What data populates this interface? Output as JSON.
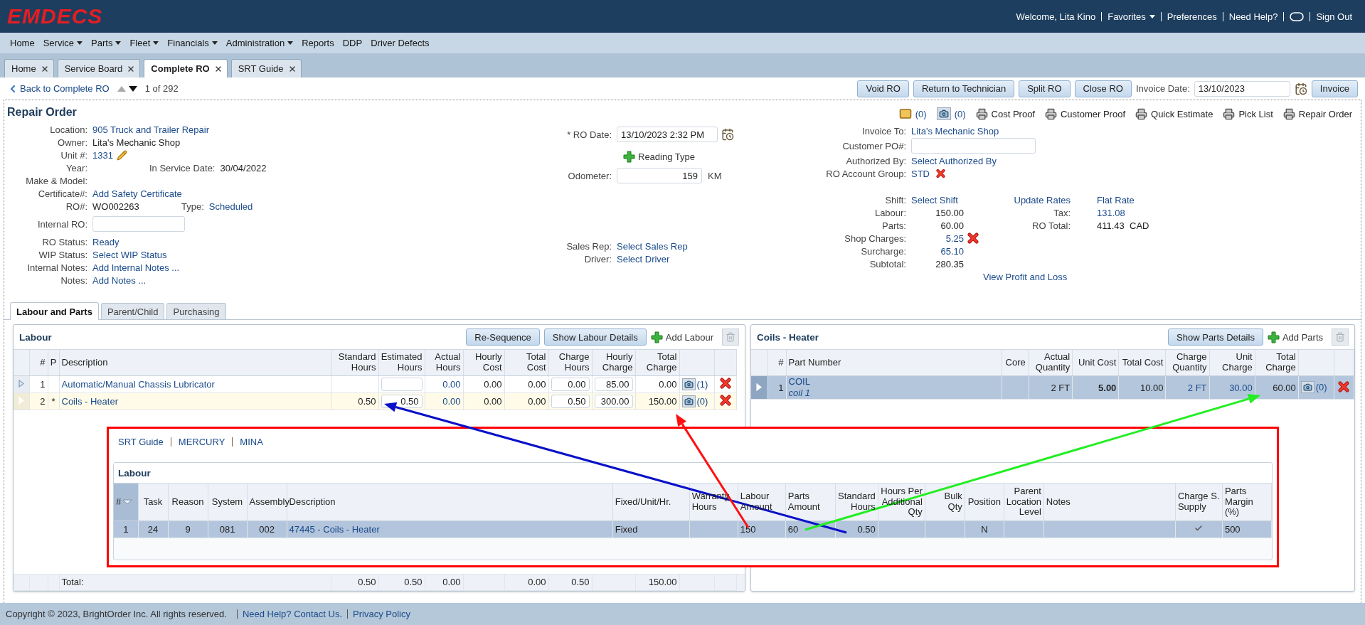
{
  "header": {
    "logo": "EMDECS",
    "items": [
      {
        "label": "Welcome, Lita Kino",
        "kind": "text"
      },
      {
        "label": "Favorites",
        "kind": "menu"
      },
      {
        "label": "Preferences",
        "kind": "link"
      },
      {
        "label": "Need Help?",
        "kind": "link"
      },
      {
        "kind": "toggle"
      },
      {
        "label": "Sign Out",
        "kind": "link"
      }
    ]
  },
  "menu": [
    {
      "label": "Home",
      "dropdown": false
    },
    {
      "label": "Service",
      "dropdown": true
    },
    {
      "label": "Parts",
      "dropdown": true
    },
    {
      "label": "Fleet",
      "dropdown": true
    },
    {
      "label": "Financials",
      "dropdown": true
    },
    {
      "label": "Administration",
      "dropdown": true
    },
    {
      "label": "Reports",
      "dropdown": false
    },
    {
      "label": "DDP",
      "dropdown": false
    },
    {
      "label": "Driver Defects",
      "dropdown": false
    }
  ],
  "tabs": [
    {
      "label": "Home",
      "selected": false
    },
    {
      "label": "Service Board",
      "selected": false
    },
    {
      "label": "Complete RO",
      "selected": true
    },
    {
      "label": "SRT Guide",
      "selected": false
    }
  ],
  "toolbar": {
    "back": "Back to Complete RO",
    "pager": {
      "text": "1 of 292",
      "prev_disabled": true,
      "next_disabled": false
    },
    "buttons": [
      "Void RO",
      "Return to Technician",
      "Split RO",
      "Close RO"
    ],
    "invoice_date_label": "Invoice Date:",
    "invoice_date": "13/10/2023",
    "invoice_button": "Invoice"
  },
  "repair_order": {
    "title": "Repair Order",
    "fields": [
      {
        "label": "Location:",
        "value": "905 Truck and Trailer Repair",
        "kind": "link"
      },
      {
        "label": "Owner:",
        "value": "Lita's Mechanic Shop",
        "kind": "text"
      },
      {
        "label": "Unit #:",
        "value": "1331",
        "kind": "link-edit"
      },
      {
        "label": "Year:",
        "kind": "text",
        "extra": {
          "label": "In Service Date:",
          "value": "30/04/2022",
          "kind": "text"
        }
      },
      {
        "label": "Make & Model:",
        "kind": "text"
      },
      {
        "label": "Certificate#:",
        "value": "Add Safety Certificate",
        "kind": "link"
      },
      {
        "label": "RO#:",
        "value": "WO002263",
        "kind": "text",
        "extra": {
          "label": "Type:",
          "value": "Scheduled",
          "kind": "link"
        }
      },
      {
        "label": "Internal RO:",
        "kind": "input"
      },
      {
        "label": "RO Status:",
        "value": "Ready",
        "kind": "link"
      },
      {
        "label": "WIP Status:",
        "value": "Select WIP Status",
        "kind": "link"
      },
      {
        "label": "Internal Notes:",
        "value": "Add Internal Notes ...",
        "kind": "link"
      },
      {
        "label": "Notes:",
        "value": "Add Notes ...",
        "kind": "link"
      }
    ],
    "ro_date": {
      "label": "* RO Date:",
      "value": "13/10/2023 2:32 PM"
    },
    "reading_type": "Reading Type",
    "odometer": {
      "label": "Odometer:",
      "value": "159",
      "unit": "KM"
    },
    "people": [
      {
        "label": "Sales Rep:",
        "value": "Select Sales Rep"
      },
      {
        "label": "Driver:",
        "value": "Select Driver"
      }
    ],
    "documents": [
      {
        "kind": "mail",
        "label": "(0)"
      },
      {
        "kind": "camera",
        "label": "(0)"
      },
      {
        "kind": "print",
        "label": "Cost Proof"
      },
      {
        "kind": "print",
        "label": "Customer Proof"
      },
      {
        "kind": "print",
        "label": "Quick Estimate"
      },
      {
        "kind": "print",
        "label": "Pick List"
      },
      {
        "kind": "print",
        "label": "Repair Order"
      }
    ],
    "billing": [
      {
        "label": "Invoice To:",
        "value": "Lita's Mechanic Shop",
        "kind": "link",
        "removable": false
      },
      {
        "label": "Customer PO#:",
        "kind": "input",
        "removable": false
      },
      {
        "label": "Authorized By:",
        "value": "Select Authorized By",
        "kind": "link",
        "removable": false
      },
      {
        "label": "RO Account Group:",
        "value": "STD",
        "kind": "link",
        "removable": true
      }
    ],
    "totals": [
      {
        "label": "Shift:",
        "value": "Select Shift",
        "kind": "link",
        "removable": false
      },
      {
        "label": "Labour:",
        "value": "150.00",
        "kind": "amount",
        "removable": false
      },
      {
        "label": "Parts:",
        "value": "60.00",
        "kind": "amount",
        "removable": false
      },
      {
        "label": "Shop Charges:",
        "value": "5.25",
        "kind": "amount-link",
        "removable": true
      },
      {
        "label": "Surcharge:",
        "value": "65.10",
        "kind": "amount-link",
        "removable": false
      },
      {
        "label": "Subtotal:",
        "value": "280.35",
        "kind": "amount",
        "removable": false
      }
    ],
    "rates": {
      "update": "Update Rates",
      "flat": "Flat Rate"
    },
    "tax": [
      {
        "label": "Tax:",
        "value": "131.08",
        "kind": "link"
      },
      {
        "label": "RO Total:",
        "value": "411.43  CAD",
        "kind": "text"
      }
    ],
    "profit_link": "View Profit and Loss"
  },
  "section_tabs": [
    {
      "label": "Labour and Parts",
      "selected": true
    },
    {
      "label": "Parent/Child",
      "selected": false
    },
    {
      "label": "Purchasing",
      "selected": false
    }
  ],
  "labour": {
    "title": "Labour",
    "buttons": [
      "Re-Sequence",
      "Show Labour Details"
    ],
    "add": "Add Labour",
    "trash_disabled": true,
    "columns": [
      {
        "label": "#",
        "kind": "num"
      },
      {
        "label": "P",
        "kind": "center"
      },
      {
        "label": "Description",
        "kind": "link"
      },
      {
        "label": "Standard Hours",
        "kind": "num"
      },
      {
        "label": "Estimated Hours",
        "kind": "input"
      },
      {
        "label": "Actual Hours",
        "kind": "link-num"
      },
      {
        "label": "Hourly Cost",
        "kind": "num"
      },
      {
        "label": "Total Cost",
        "kind": "num"
      },
      {
        "label": "Charge Hours",
        "kind": "input"
      },
      {
        "label": "Hourly Charge",
        "kind": "input"
      },
      {
        "label": "Total Charge",
        "kind": "num"
      }
    ],
    "rows": [
      {
        "selected": false,
        "cells": [
          "1",
          null,
          "Automatic/Manual Chassis Lubricator",
          null,
          null,
          "0.00",
          "0.00",
          "0.00",
          "0.00",
          "85.00",
          "0.00"
        ],
        "photos": "(1)"
      },
      {
        "selected": true,
        "cells": [
          "2",
          "*",
          "Coils - Heater",
          "0.50",
          "0.50",
          "0.00",
          "0.00",
          "0.00",
          "0.50",
          "300.00",
          "150.00"
        ],
        "photos": "(0)"
      }
    ],
    "total": {
      "label": "Total:",
      "standard_hours": "0.50",
      "estimated_hours": "0.50",
      "actual_hours": "0.00",
      "total_cost": "0.00",
      "charge_hours": "0.50",
      "total_charge": "150.00"
    }
  },
  "parts": {
    "title": "Coils - Heater",
    "button": "Show Parts Details",
    "add": "Add Parts",
    "trash_disabled": true,
    "columns": [
      {
        "label": "#",
        "kind": "num"
      },
      {
        "label": "Part Number",
        "kind": "part"
      },
      {
        "label": "Core",
        "kind": "center"
      },
      {
        "label": "Actual Quantity",
        "kind": "num"
      },
      {
        "label": "Unit Cost",
        "kind": "bold-num"
      },
      {
        "label": "Total Cost",
        "kind": "num"
      },
      {
        "label": "Charge Quantity",
        "kind": "link-num"
      },
      {
        "label": "Unit Charge",
        "kind": "link-num"
      },
      {
        "label": "Total Charge",
        "kind": "num"
      }
    ],
    "rows": [
      {
        "selected": true,
        "cells": [
          "1",
          "COIL",
          null,
          "2 FT",
          "5.00",
          "10.00",
          "2 FT",
          "30.00",
          "60.00"
        ],
        "subtitle": "coil 1",
        "photos": "(0)"
      }
    ]
  },
  "srt_guide": {
    "links": [
      "SRT Guide",
      "MERCURY",
      "MINA"
    ],
    "title": "Labour",
    "columns": [
      {
        "label": "#",
        "kind": "center"
      },
      {
        "label": "Task",
        "kind": "center"
      },
      {
        "label": "Reason",
        "kind": "center"
      },
      {
        "label": "System",
        "kind": "center"
      },
      {
        "label": "Assembly",
        "kind": "center"
      },
      {
        "label": "Description",
        "kind": "link"
      },
      {
        "label": "Fixed/Unit/Hr.",
        "kind": "left"
      },
      {
        "label": "Warranty Hours",
        "kind": "left"
      },
      {
        "label": "Labour Amount",
        "kind": "left"
      },
      {
        "label": "Parts Amount",
        "kind": "left"
      },
      {
        "label": "Standard Hours",
        "kind": "right"
      },
      {
        "label": "Hours Per Additional Qty",
        "kind": "right"
      },
      {
        "label": "Bulk Qty",
        "kind": "right"
      },
      {
        "label": "Position",
        "kind": "center"
      },
      {
        "label": "Parent Location Level",
        "kind": "right"
      },
      {
        "label": "Notes",
        "kind": "left"
      },
      {
        "label": "Charge S. Supply",
        "kind": "check"
      },
      {
        "label": "Parts Margin (%)",
        "kind": "left"
      }
    ],
    "rows": [
      {
        "selected": true,
        "cells": [
          "1",
          "24",
          "9",
          "081",
          "002",
          "47445 - Coils - Heater",
          "Fixed",
          null,
          "150",
          "60",
          "0.50",
          null,
          null,
          "N",
          null,
          null,
          true,
          "500"
        ]
      }
    ]
  },
  "footer": {
    "copyright": "Copyright © 2023, BrightOrder Inc. All rights reserved.",
    "links": [
      "Need Help? Contact Us.",
      "Privacy Policy"
    ]
  }
}
